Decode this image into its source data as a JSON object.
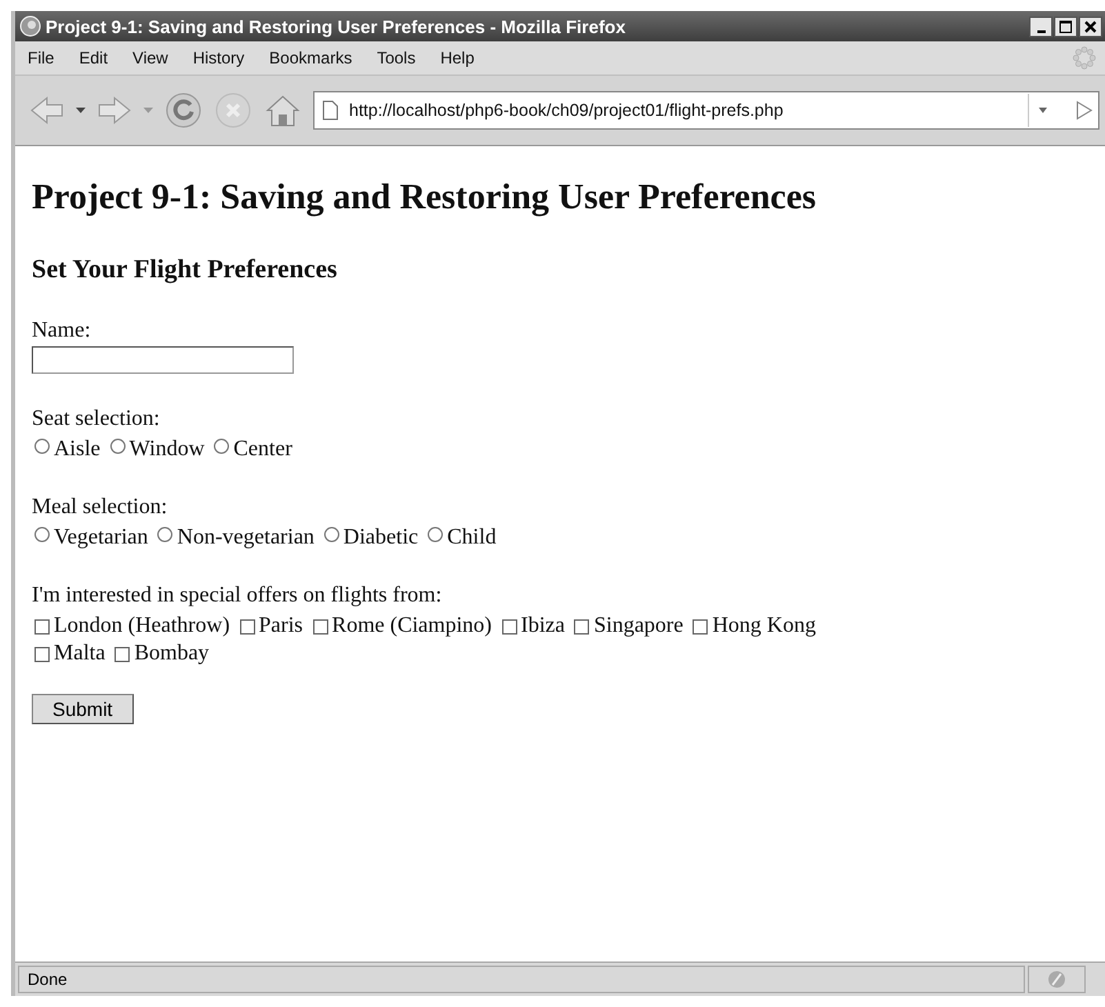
{
  "window": {
    "title": "Project 9-1: Saving and Restoring User Preferences - Mozilla Firefox"
  },
  "menu": [
    "File",
    "Edit",
    "View",
    "History",
    "Bookmarks",
    "Tools",
    "Help"
  ],
  "address": {
    "value": "http://localhost/php6-book/ch09/project01/flight-prefs.php"
  },
  "page": {
    "heading": "Project 9-1: Saving and Restoring User Preferences",
    "subheading": "Set Your Flight Preferences",
    "name_label": "Name:",
    "seat_label": "Seat selection:",
    "seats": [
      {
        "label": "Aisle",
        "selected": false
      },
      {
        "label": "Window",
        "selected": false
      },
      {
        "label": "Center",
        "selected": false
      }
    ],
    "meal_label": "Meal selection:",
    "meals": [
      {
        "label": "Vegetarian",
        "selected": false
      },
      {
        "label": "Non-vegetarian",
        "selected": false
      },
      {
        "label": "Diabetic",
        "selected": false
      },
      {
        "label": "Child",
        "selected": false
      }
    ],
    "offers_label": "I'm interested in special offers on flights from:",
    "offers": [
      {
        "label": "London (Heathrow)",
        "checked": false
      },
      {
        "label": "Paris",
        "checked": false
      },
      {
        "label": "Rome (Ciampino)",
        "checked": false
      },
      {
        "label": "Ibiza",
        "checked": false
      },
      {
        "label": "Singapore",
        "checked": false
      },
      {
        "label": "Hong Kong",
        "checked": false
      },
      {
        "label": "Malta",
        "checked": false
      },
      {
        "label": "Bombay",
        "checked": false
      }
    ],
    "submit": "Submit"
  },
  "status_bar": {
    "text": "Done"
  }
}
